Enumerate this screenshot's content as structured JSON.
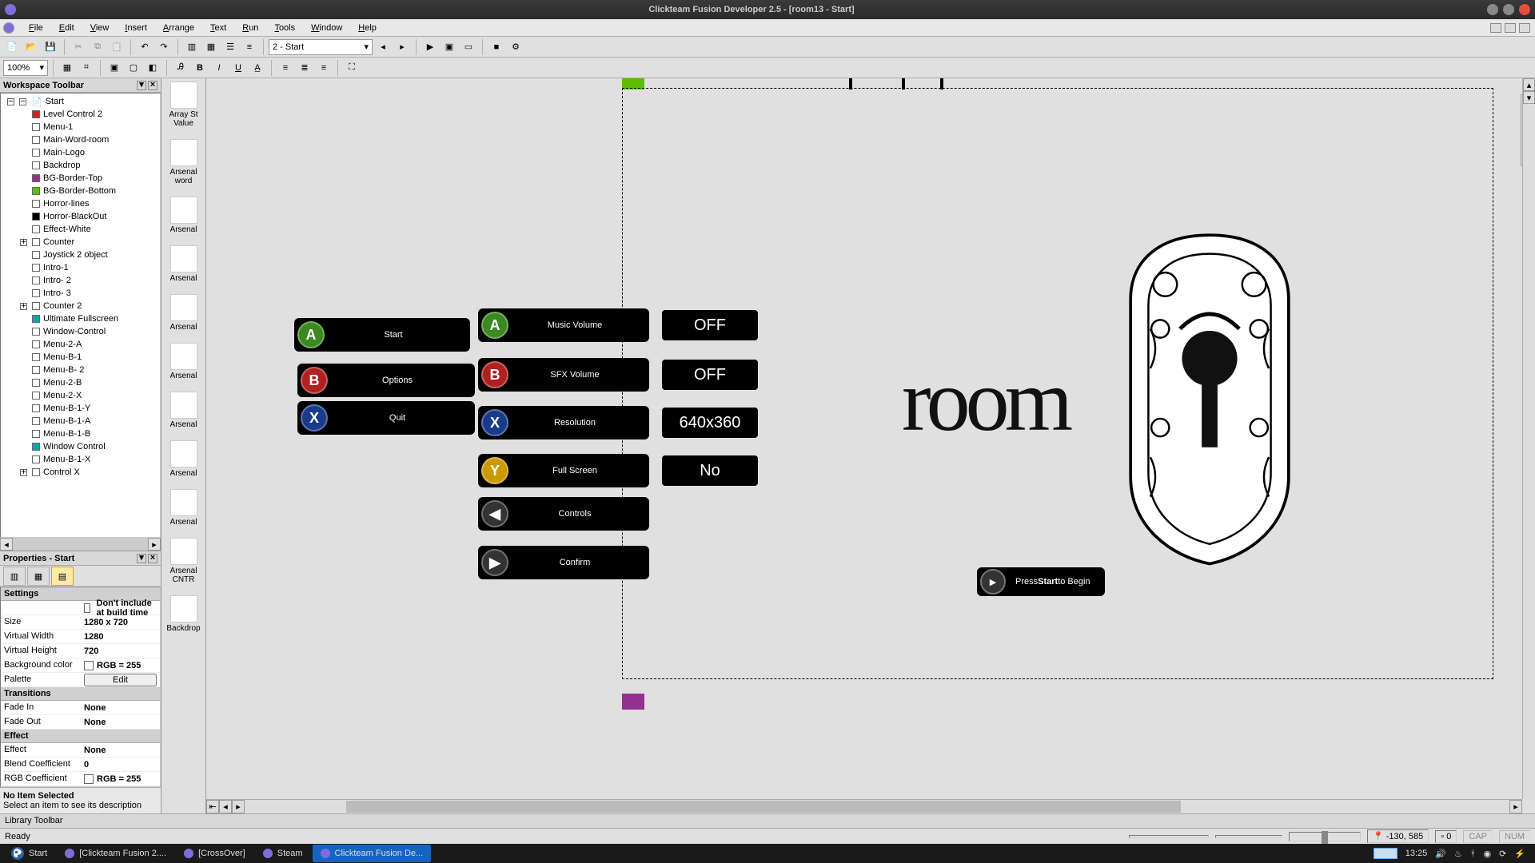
{
  "os_title": "Clickteam Fusion Developer 2.5 - [room13 - Start]",
  "menubar": [
    "File",
    "Edit",
    "View",
    "Insert",
    "Arrange",
    "Text",
    "Run",
    "Tools",
    "Window",
    "Help"
  ],
  "toolbar": {
    "frame_select": "2 - Start",
    "zoom": "100%"
  },
  "workspace": {
    "title": "Workspace Toolbar",
    "root": "Start",
    "items": [
      {
        "label": "Level Control 2",
        "color": "#d02020"
      },
      {
        "label": "Menu-1"
      },
      {
        "label": "Main-Word-room"
      },
      {
        "label": "Main-Logo"
      },
      {
        "label": "Backdrop"
      },
      {
        "label": "BG-Border-Top",
        "color": "#94308e"
      },
      {
        "label": "BG-Border-Bottom",
        "color": "#5bbf00"
      },
      {
        "label": "Horror-lines"
      },
      {
        "label": "Horror-BlackOut",
        "color": "#000"
      },
      {
        "label": "Effect-White"
      },
      {
        "label": "Counter",
        "exp": "+"
      },
      {
        "label": "Joystick 2 object"
      },
      {
        "label": "Intro-1"
      },
      {
        "label": "Intro- 2"
      },
      {
        "label": "Intro- 3"
      },
      {
        "label": "Counter 2",
        "exp": "+"
      },
      {
        "label": "Ultimate Fullscreen",
        "color": "#0aa"
      },
      {
        "label": "Window-Control"
      },
      {
        "label": "Menu-2-A"
      },
      {
        "label": "Menu-B-1"
      },
      {
        "label": "Menu-B- 2"
      },
      {
        "label": "Menu-2-B"
      },
      {
        "label": "Menu-2-X"
      },
      {
        "label": "Menu-B-1-Y"
      },
      {
        "label": "Menu-B-1-A"
      },
      {
        "label": "Menu-B-1-B"
      },
      {
        "label": "Window Control",
        "color": "#0aa"
      },
      {
        "label": "Menu-B-1-X"
      },
      {
        "label": "Control X",
        "exp": "+"
      }
    ]
  },
  "properties": {
    "title": "Properties - Start",
    "sections": [
      {
        "name": "Settings",
        "rows": [
          {
            "k": "",
            "v": "Don't include at build time",
            "check": true
          },
          {
            "k": "Size",
            "v": "1280 x 720"
          },
          {
            "k": "Virtual Width",
            "v": "1280"
          },
          {
            "k": "Virtual Height",
            "v": "720"
          },
          {
            "k": "Background color",
            "v": "RGB = 255",
            "color": true
          },
          {
            "k": "Palette",
            "v": "Edit",
            "btn": true
          }
        ]
      },
      {
        "name": "Transitions",
        "rows": [
          {
            "k": "Fade In",
            "v": "None"
          },
          {
            "k": "Fade Out",
            "v": "None"
          }
        ]
      },
      {
        "name": "Effect",
        "rows": [
          {
            "k": "Effect",
            "v": "None"
          },
          {
            "k": "Blend Coefficient",
            "v": "0"
          },
          {
            "k": "RGB Coefficient",
            "v": "RGB = 255",
            "color": true
          }
        ]
      }
    ],
    "desc_title": "No Item Selected",
    "desc_body": "Select an item to see its description"
  },
  "objstrip": [
    "Array St Value",
    "Arsenal word",
    "Arsenal",
    "Arsenal",
    "Arsenal",
    "Arsenal",
    "Arsenal",
    "Arsenal",
    "Arsenal",
    "Arsenal CNTR",
    "Backdrop"
  ],
  "game": {
    "main_menu": [
      {
        "btn": "A",
        "cls": "btnA",
        "label": "Start"
      },
      {
        "btn": "B",
        "cls": "btnB",
        "label": "Options"
      },
      {
        "btn": "X",
        "cls": "btnX",
        "label": "Quit"
      }
    ],
    "opts_menu": [
      {
        "btn": "A",
        "cls": "btnA",
        "label": "Music Volume",
        "val": "OFF"
      },
      {
        "btn": "B",
        "cls": "btnB",
        "label": "SFX Volume",
        "val": "OFF"
      },
      {
        "btn": "X",
        "cls": "btnX",
        "label": "Resolution",
        "val": "640x360"
      },
      {
        "btn": "Y",
        "cls": "btnY",
        "label": "Full Screen",
        "val": "No"
      },
      {
        "btn": "◀",
        "cls": "btnNav",
        "label": "Controls"
      },
      {
        "btn": "▶",
        "cls": "btnNav",
        "label": "Confirm"
      }
    ],
    "room_text": "room",
    "press_pre": "Press ",
    "press_bold": "Start",
    "press_post": " to Begin"
  },
  "library_title": "Library Toolbar",
  "status": {
    "ready": "Ready",
    "coords": "-130, 585",
    "count": "0",
    "cap": "CAP",
    "num": "NUM"
  },
  "taskbar": {
    "start": "Start",
    "tasks": [
      {
        "label": "[Clickteam Fusion 2....",
        "active": false,
        "icon": "chrome"
      },
      {
        "label": "[CrossOver]",
        "active": false,
        "icon": "cross"
      },
      {
        "label": "Steam",
        "active": false,
        "icon": "steam"
      },
      {
        "label": "Clickteam Fusion De...",
        "active": true,
        "icon": "cf"
      }
    ],
    "clock": "13:25"
  }
}
